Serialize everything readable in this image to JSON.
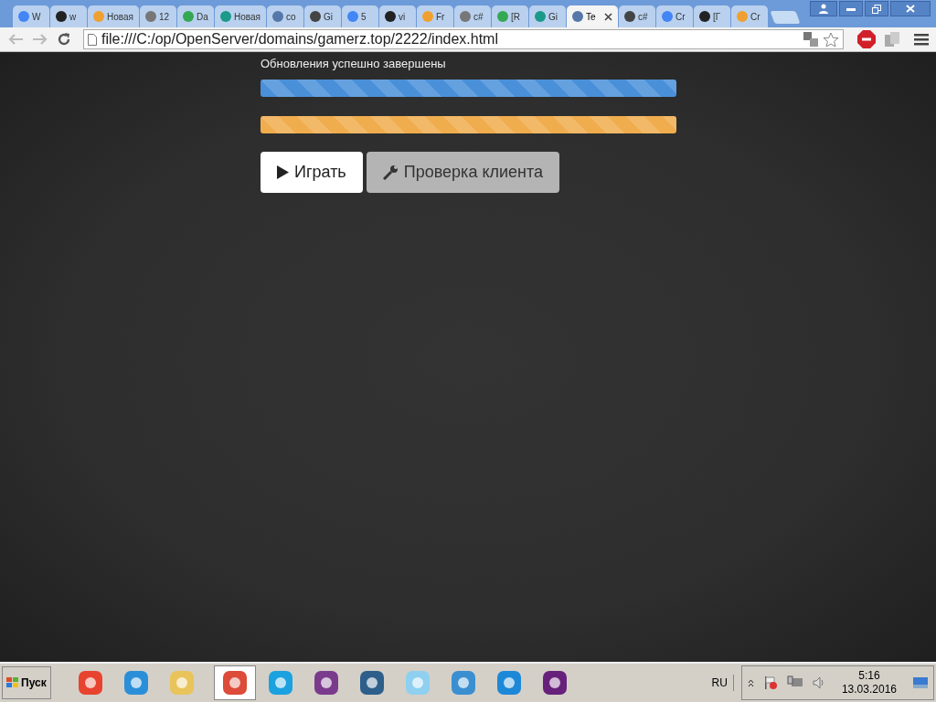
{
  "tabs": [
    {
      "title": "W",
      "selected": false
    },
    {
      "title": "w",
      "selected": false
    },
    {
      "title": "Новая",
      "selected": false
    },
    {
      "title": "12",
      "selected": false
    },
    {
      "title": "Da",
      "selected": false
    },
    {
      "title": "Новая",
      "selected": false
    },
    {
      "title": "co",
      "selected": false
    },
    {
      "title": "Gi",
      "selected": false
    },
    {
      "title": "5",
      "selected": false
    },
    {
      "title": "vi",
      "selected": false
    },
    {
      "title": "Fr",
      "selected": false
    },
    {
      "title": "c#",
      "selected": false
    },
    {
      "title": "[R",
      "selected": false
    },
    {
      "title": "Gi",
      "selected": false
    },
    {
      "title": "Te",
      "selected": true
    },
    {
      "title": "c#",
      "selected": false
    },
    {
      "title": "Cr",
      "selected": false
    },
    {
      "title": "[Г",
      "selected": false
    },
    {
      "title": "Cr",
      "selected": false
    }
  ],
  "address_bar": {
    "url": "file:///C:/op/OpenServer/domains/gamerz.top/2222/index.html"
  },
  "page": {
    "status": "Обновления успешно завершены",
    "progress_bars": [
      {
        "level": 1,
        "color": "#4a90d9"
      },
      {
        "level": 1,
        "color": "#f0ad4e"
      }
    ],
    "buttons": [
      {
        "label": "Играть",
        "kind": "play"
      },
      {
        "label": "Проверка клиента",
        "kind": "check"
      }
    ]
  },
  "taskbar": {
    "start": "Пуск",
    "apps": [
      {
        "selected": false
      },
      {
        "selected": false
      },
      {
        "selected": false
      },
      {
        "selected": true
      },
      {
        "selected": false
      },
      {
        "selected": false
      },
      {
        "selected": false
      },
      {
        "selected": false
      },
      {
        "selected": false
      },
      {
        "selected": false
      },
      {
        "selected": false
      }
    ],
    "language": "RU",
    "time": "5:16",
    "date": "13.03.2016"
  }
}
